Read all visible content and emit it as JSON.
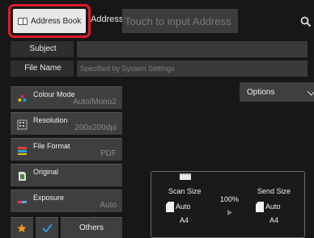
{
  "header": {
    "address_book_label": "Address Book",
    "address_label": "Address",
    "address_placeholder": "Touch to input Address",
    "search_icon": "magnifier-icon"
  },
  "fields": {
    "subject_label": "Subject",
    "subject_value": "",
    "file_name_label": "File Name",
    "file_name_placeholder": "Specified by System Settings"
  },
  "settings": [
    {
      "label": "Colour Mode",
      "value": "Auto/Mono2",
      "icon": "colour-mode-icon"
    },
    {
      "label": "Resolution",
      "value": "200x200dpi",
      "icon": "resolution-icon"
    },
    {
      "label": "File Format",
      "value": "PDF",
      "icon": "file-format-icon"
    },
    {
      "label": "Original",
      "value": "",
      "icon": "original-icon"
    },
    {
      "label": "Exposure",
      "value": "Auto",
      "icon": "exposure-icon"
    }
  ],
  "bottom": {
    "others_label": "Others"
  },
  "options_label": "Options",
  "panel": {
    "scan_size_label": "Scan Size",
    "scan_size_mode": "Auto",
    "scan_size_paper": "A4",
    "ratio": "100%",
    "send_size_label": "Send Size",
    "send_size_mode": "Auto",
    "send_size_paper": "A4"
  },
  "colors": {
    "highlight": "#e01a2a",
    "favourite_star": "#f29a1a",
    "check": "#2e9bd6"
  }
}
